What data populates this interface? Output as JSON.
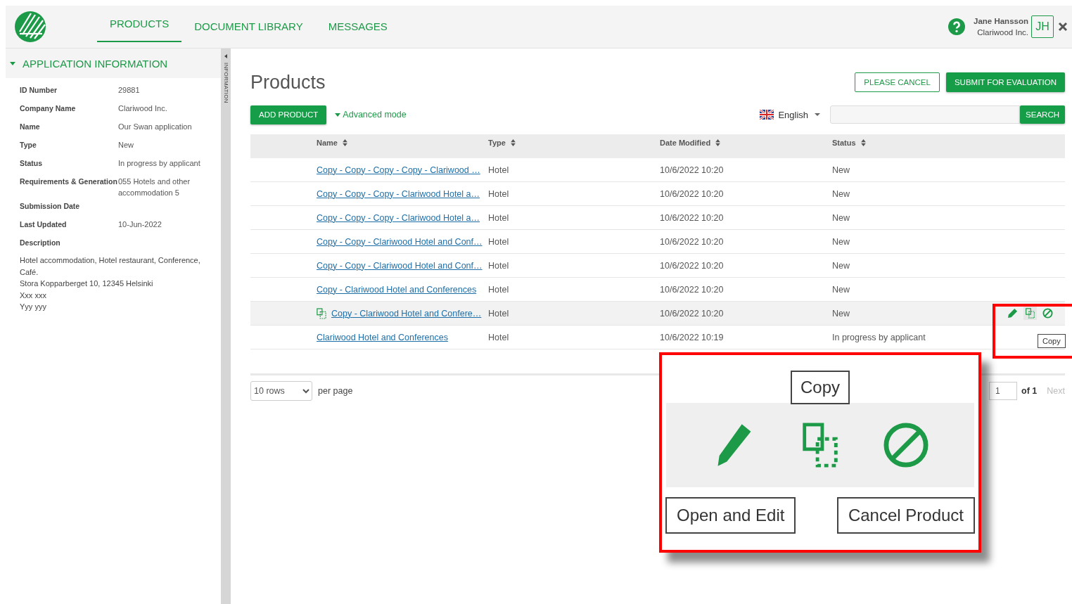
{
  "nav": {
    "tabs": [
      {
        "label": "PRODUCTS",
        "selected": true
      },
      {
        "label": "DOCUMENT LIBRARY",
        "selected": false
      },
      {
        "label": "MESSAGES",
        "selected": false
      }
    ]
  },
  "user": {
    "name": "Jane Hansson",
    "company": "Clariwood Inc.",
    "initials": "JH"
  },
  "sidebar": {
    "title": "APPLICATION INFORMATION",
    "expanded": true,
    "splitter_label": "INFORMATION",
    "fields": [
      {
        "label": "ID Number",
        "value": "29881"
      },
      {
        "label": "Company Name",
        "value": "Clariwood Inc."
      },
      {
        "label": "Name",
        "value": "Our Swan application"
      },
      {
        "label": "Type",
        "value": "New"
      },
      {
        "label": "Status",
        "value": "In progress by applicant"
      },
      {
        "label": "Requirements & Generation",
        "value": "055 Hotels and other accommodation 5"
      },
      {
        "label": "Submission Date"
      },
      {
        "label": "Last Updated",
        "value": "10-Jun-2022"
      },
      {
        "label": "Description"
      }
    ],
    "description": [
      "Hotel accommodation, Hotel restaurant, Conference, Café.",
      "Stora Kopparberget 10, 12345 Helsinki",
      "Xxx xxx",
      "Yyy yyy"
    ]
  },
  "page": {
    "title": "Products",
    "buttons": [
      {
        "label": "PLEASE CANCEL",
        "kind": "outline"
      },
      {
        "label": "SUBMIT FOR EVALUATION",
        "kind": "primary"
      }
    ]
  },
  "toolbar": {
    "add_button": "ADD PRODUCT",
    "advanced_mode": "Advanced mode",
    "language": "English",
    "search_button": "SEARCH"
  },
  "table": {
    "columns": [
      "Name",
      "Type",
      "Date Modified",
      "Status"
    ],
    "rows": [
      {
        "name": "Copy - Copy - Copy - Copy - Clariwood …",
        "type": "Hotel",
        "date": "10/6/2022 10:20",
        "status": "New",
        "hovered": false
      },
      {
        "name": "Copy - Copy - Copy - Clariwood Hotel a…",
        "type": "Hotel",
        "date": "10/6/2022 10:20",
        "status": "New",
        "hovered": false
      },
      {
        "name": "Copy - Copy - Copy - Clariwood Hotel a…",
        "type": "Hotel",
        "date": "10/6/2022 10:20",
        "status": "New",
        "hovered": false
      },
      {
        "name": "Copy - Copy - Clariwood Hotel and Conf…",
        "type": "Hotel",
        "date": "10/6/2022 10:20",
        "status": "New",
        "hovered": false
      },
      {
        "name": "Copy - Copy - Clariwood Hotel and Conf…",
        "type": "Hotel",
        "date": "10/6/2022 10:20",
        "status": "New",
        "hovered": false
      },
      {
        "name": "Copy - Clariwood Hotel and Conferences",
        "type": "Hotel",
        "date": "10/6/2022 10:20",
        "status": "New",
        "hovered": false
      },
      {
        "name": "Copy - Clariwood Hotel and Confere…",
        "type": "Hotel",
        "date": "10/6/2022 10:20",
        "status": "New",
        "hovered": true
      },
      {
        "name": "Clariwood Hotel and Conferences",
        "type": "Hotel",
        "date": "10/6/2022 10:19",
        "status": "In progress by applicant",
        "hovered": false
      }
    ],
    "row_tooltip": "Copy"
  },
  "pagination": {
    "rows_per_page": "10 rows",
    "per_page_label": "per page",
    "page": "1",
    "of_label": "of 1",
    "next": {
      "label": "Next",
      "disabled": true
    }
  },
  "callout": {
    "tooltip": "Copy",
    "labels": [
      "Open and Edit",
      "Cancel Product"
    ]
  }
}
